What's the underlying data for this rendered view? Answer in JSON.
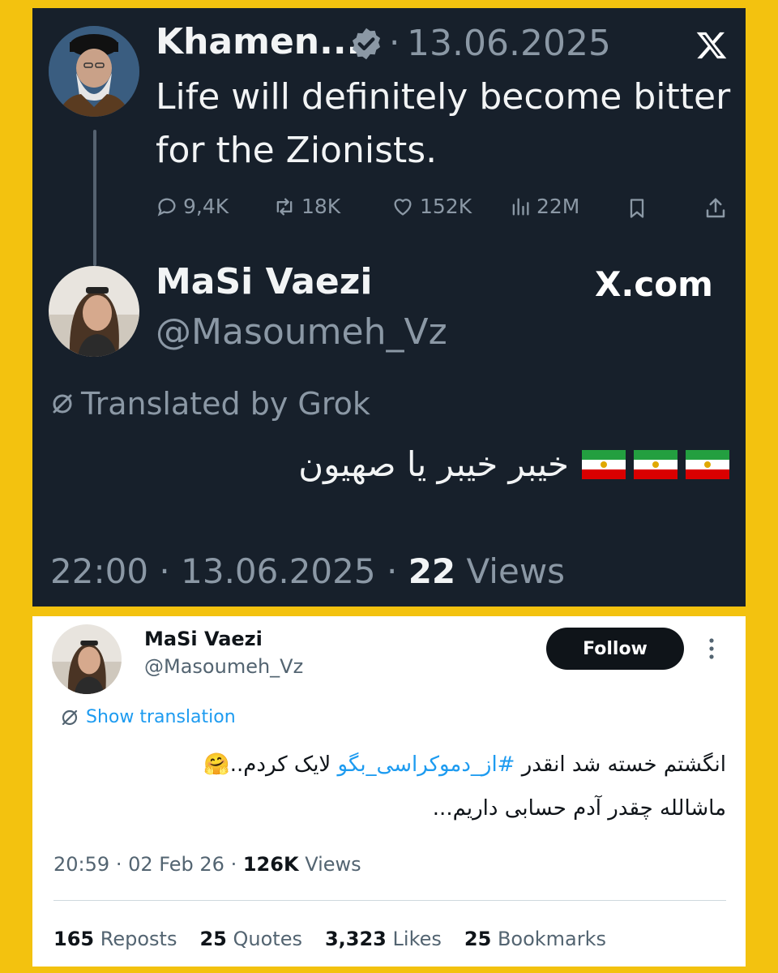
{
  "top_tweet": {
    "name": "Khamen...",
    "separator": "·",
    "date": "13.06.2025",
    "text_line1": "Life will definitely become bitter",
    "text_line2": "for the Zionists.",
    "stats": {
      "replies": "9,4K",
      "reposts": "18K",
      "likes": "152K",
      "views": "22M"
    }
  },
  "reply_tweet": {
    "name": "MaSi Vaezi",
    "handle": "@Masoumeh_Vz",
    "site": "X.com",
    "translated_label": "Translated by Grok",
    "text": "خیبر خیبر یا صهیون",
    "time": "22:00",
    "sep1": "·",
    "date": "13.06.2025",
    "sep2": "·",
    "views_count": "22",
    "views_label": "Views"
  },
  "bottom_tweet": {
    "name": "MaSi Vaezi",
    "handle": "@Masoumeh_Vz",
    "follow_label": "Follow",
    "show_translation": "Show translation",
    "line1_before": "انگشتم خسته شد انقدر ",
    "line1_hashtag": "#از_دموکراسی_بگو",
    "line1_after": " لایک کردم..",
    "line1_emoji": "🤗",
    "line2": "ماشالله چقدر آدم حسابی داریم...",
    "time": "20:59",
    "sep1": "·",
    "date": "02 Feb 26",
    "sep2": "·",
    "views_count": "126K",
    "views_label": "Views",
    "counts": {
      "reposts_num": "165",
      "reposts_label": "Reposts",
      "quotes_num": "25",
      "quotes_label": "Quotes",
      "likes_num": "3,323",
      "likes_label": "Likes",
      "bookmarks_num": "25",
      "bookmarks_label": "Bookmarks"
    }
  },
  "colors": {
    "frame": "#f3c20f",
    "dark_bg": "#17202b",
    "muted": "#8b98a5",
    "link": "#1d9bf0",
    "verified": "#8b98a5"
  }
}
